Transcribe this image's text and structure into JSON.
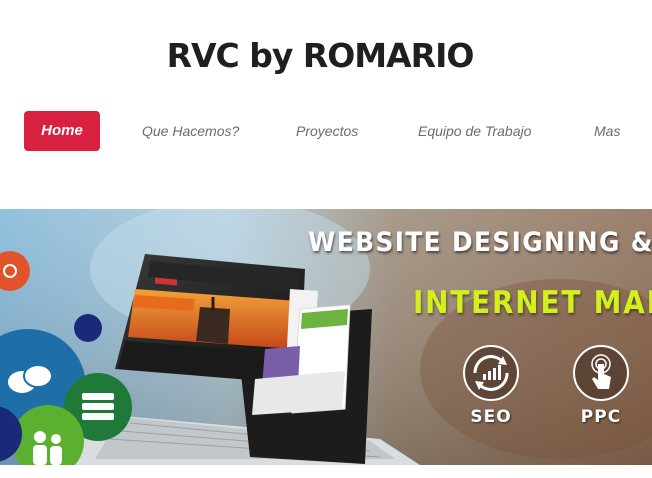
{
  "site": {
    "title": "RVC by ROMARIO"
  },
  "nav": {
    "items": [
      {
        "label": "Home",
        "active": true
      },
      {
        "label": "Que Hacemos?",
        "active": false
      },
      {
        "label": "Proyectos",
        "active": false
      },
      {
        "label": "Equipo de Trabajo",
        "active": false
      },
      {
        "label": "Mas",
        "active": false
      }
    ]
  },
  "banner": {
    "heading_line1": "WEBSITE DESIGNING &",
    "heading_line2": "INTERNET MAR",
    "badges": [
      {
        "label": "SEO",
        "icon": "seo-chart-icon"
      },
      {
        "label": "PPC",
        "icon": "ppc-click-icon"
      }
    ],
    "icons": [
      "share-icon",
      "chat-icon",
      "database-icon",
      "people-icon"
    ]
  },
  "colors": {
    "accent": "#d8213f",
    "title": "#1f1f1f",
    "nav_text": "#6b6b6b",
    "banner_green_text": "#d4f01c"
  }
}
